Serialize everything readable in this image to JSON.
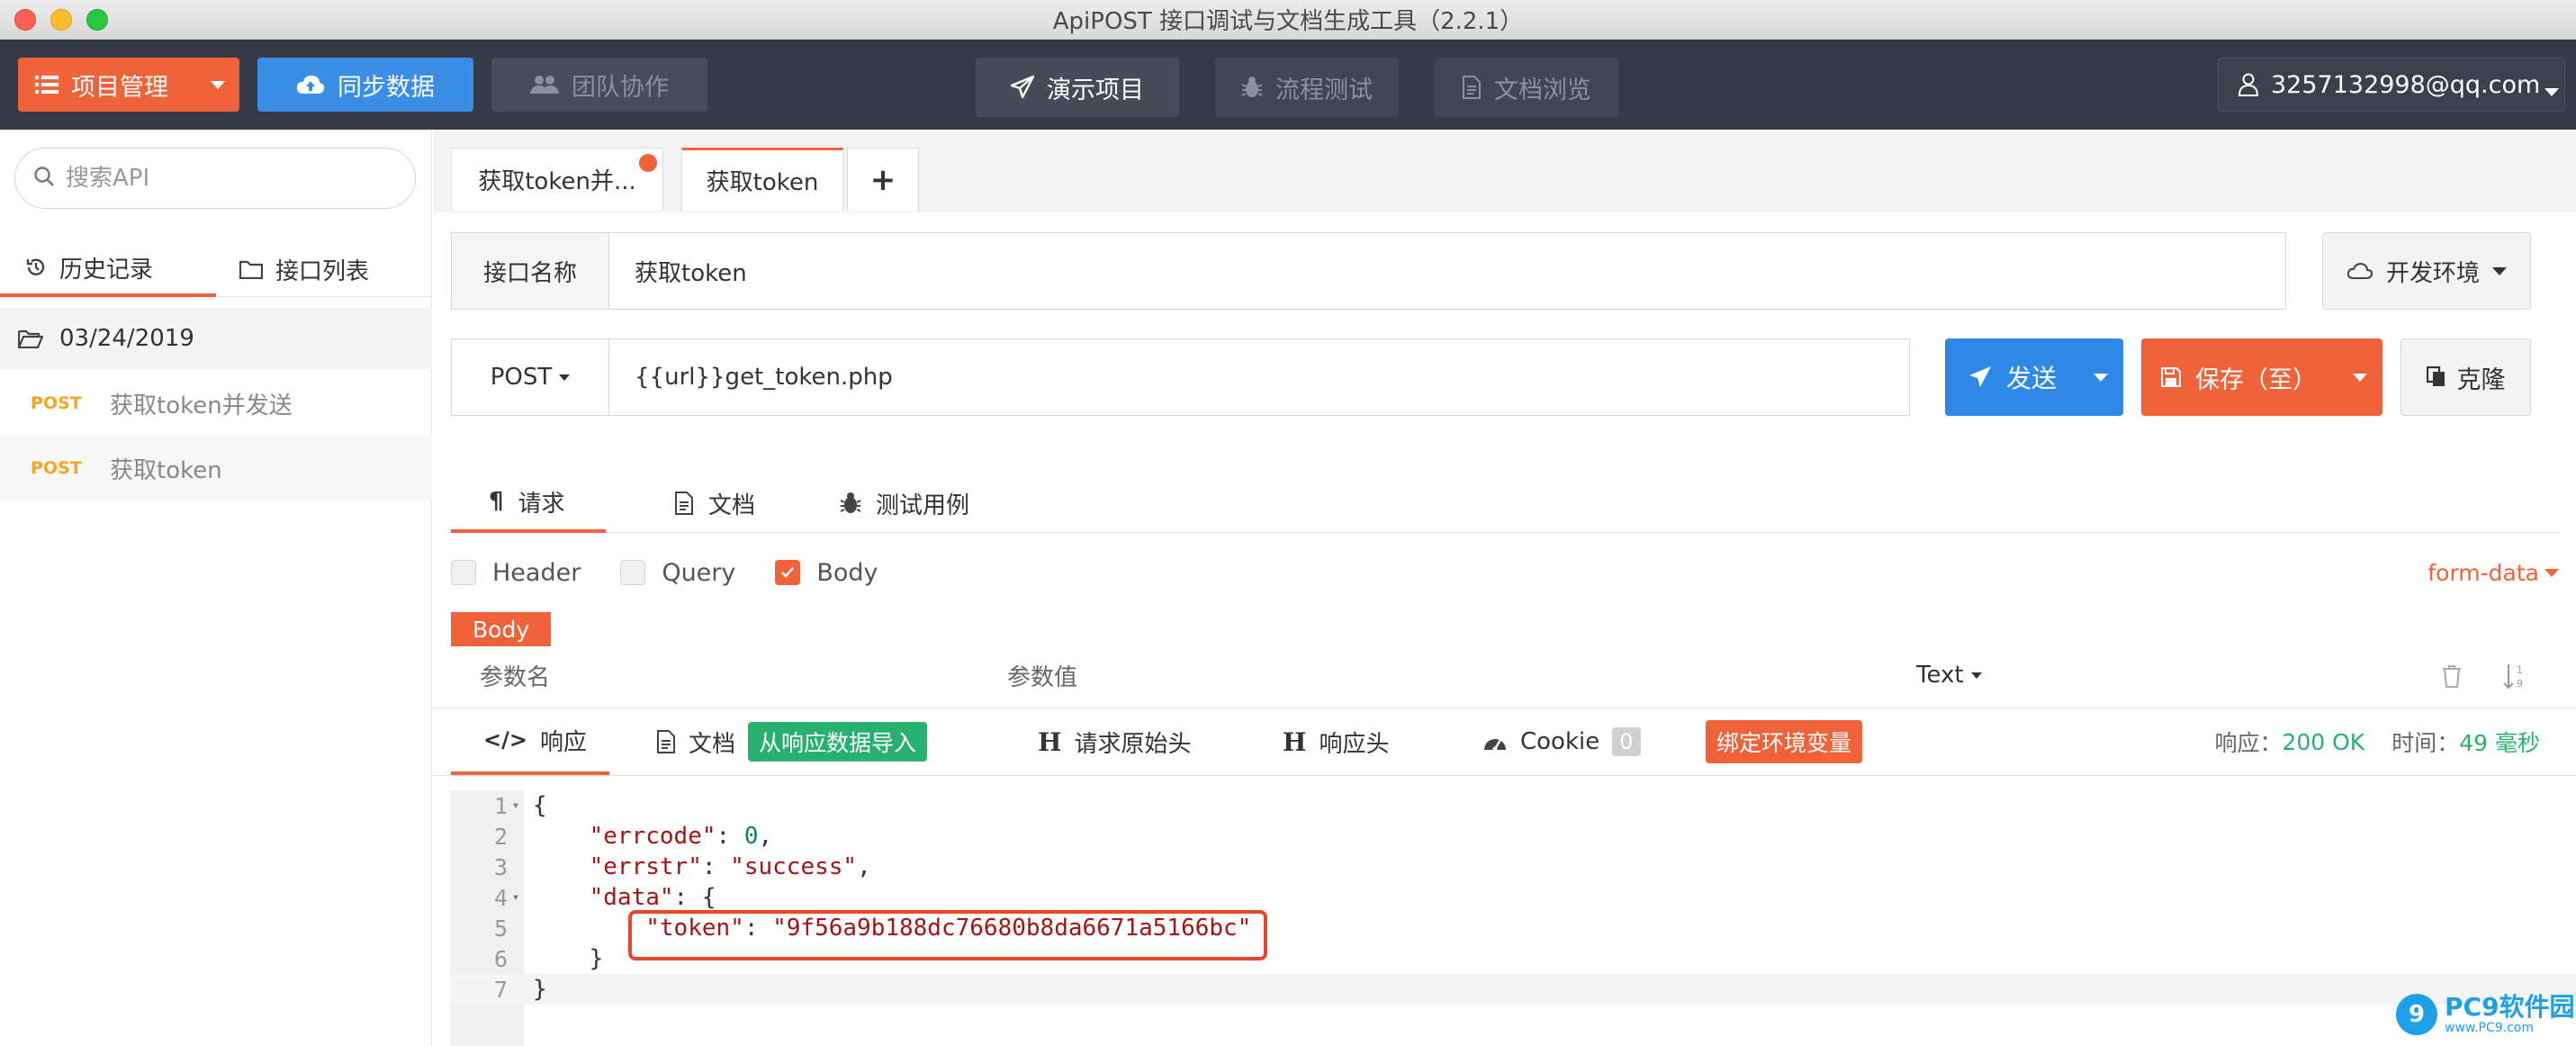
{
  "window": {
    "title": "ApiPOST 接口调试与文档生成工具（2.2.1）"
  },
  "topnav": {
    "project_label": "项目管理",
    "sync_label": "同步数据",
    "team_label": "团队协作",
    "demo_label": "演示项目",
    "flow_label": "流程测试",
    "docs_label": "文档浏览",
    "user_email": "3257132998@qq.com"
  },
  "sidebar": {
    "search_placeholder": "搜索API",
    "tabs": {
      "history": "历史记录",
      "list": "接口列表"
    },
    "date_group": "03/24/2019",
    "items": [
      {
        "method": "POST",
        "name": "获取token并发送"
      },
      {
        "method": "POST",
        "name": "获取token"
      }
    ]
  },
  "doc_tabs": [
    {
      "label": "获取token并..."
    },
    {
      "label": "获取token"
    }
  ],
  "doc_tabs_add": "+",
  "request": {
    "name_label": "接口名称",
    "name_value": "获取token",
    "env_label": "开发环境",
    "method": "POST",
    "url": "{{url}}get_token.php",
    "send_label": "发送",
    "save_label": "保存（至）",
    "clone_label": "克隆",
    "tabs": {
      "req": "请求",
      "doc": "文档",
      "test": "测试用例"
    },
    "checks": {
      "header": "Header",
      "query": "Query",
      "body": "Body"
    },
    "body_type": "form-data",
    "body_tag": "Body",
    "param_name_label": "参数名",
    "param_value_label": "参数值",
    "param_type": "Text"
  },
  "response": {
    "tabs": {
      "resp": "响应",
      "doc": "文档",
      "import": "从响应数据导入",
      "raw_headers": "请求原始头",
      "resp_headers": "响应头",
      "cookie": "Cookie",
      "cookie_count": "0",
      "bind_env": "绑定环境变量"
    },
    "status_label": "响应：",
    "status_value": "200 OK",
    "time_label": "时间：",
    "time_value": "49 毫秒",
    "code": {
      "l1": "{",
      "l2_key": "\"errcode\"",
      "l2_val": "0",
      "l3_key": "\"errstr\"",
      "l3_val": "\"success\"",
      "l4_key": "\"data\"",
      "l5_key": "\"token\"",
      "l5_val": "\"9f56a9b188dc76680b8da6671a5166bc\"",
      "l6": "}",
      "l7": "}"
    },
    "line_numbers": [
      "1",
      "2",
      "3",
      "4",
      "5",
      "6",
      "7"
    ]
  },
  "watermark": {
    "logo": "9",
    "name": "PC9软件园",
    "url": "www.PC9.com"
  },
  "colors": {
    "accent": "#f0623a",
    "primary": "#3a8ee6",
    "nav_bg": "#343a46",
    "success": "#27b070"
  },
  "icons": {
    "project": "list-icon",
    "sync": "cloud-upload-icon",
    "team": "users-icon",
    "demo": "paper-plane-icon",
    "flow": "bug-icon",
    "docs": "document-icon",
    "user": "user-icon",
    "search": "search-icon",
    "history": "history-icon",
    "list": "folder-icon"
  }
}
